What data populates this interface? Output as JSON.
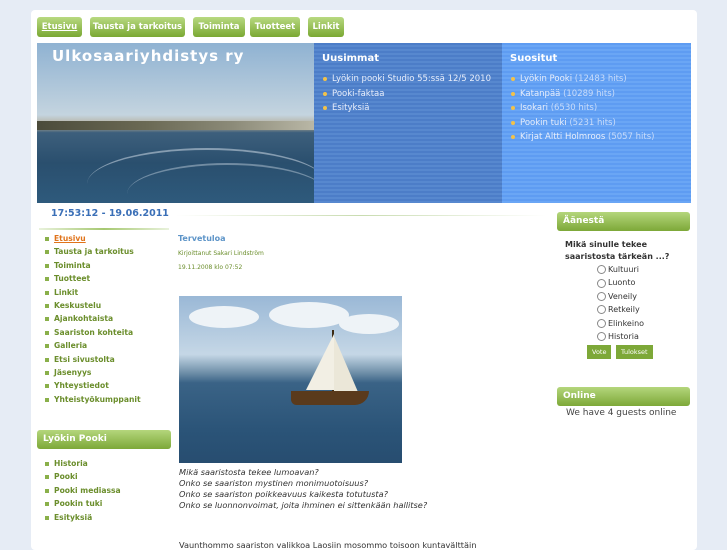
{
  "nav": {
    "tabs": [
      {
        "label": "Etusivu"
      },
      {
        "label": "Tausta ja tarkoitus"
      },
      {
        "label": "Toiminta"
      },
      {
        "label": "Tuotteet"
      },
      {
        "label": "Linkit"
      }
    ]
  },
  "header": {
    "site_title": "Ulkosaariyhdistys ry",
    "latest": {
      "title": "Uusimmat",
      "items": [
        "Lyökin pooki Studio 55:ssä 12/5 2010",
        "Pooki-faktaa",
        "Esityksiä"
      ]
    },
    "popular": {
      "title": "Suositut",
      "items": [
        {
          "label": "Lyökin Pooki",
          "hits": "(12483 hits)"
        },
        {
          "label": "Katanpää",
          "hits": "(10289 hits)"
        },
        {
          "label": "Isokari",
          "hits": "(6530 hits)"
        },
        {
          "label": "Pookin tuki",
          "hits": "(5231 hits)"
        },
        {
          "label": "Kirjat Altti Holmroos",
          "hits": "(5057 hits)"
        }
      ]
    }
  },
  "clock": "17:53:12 - 19.06.2011",
  "main_menu": [
    "Etusivu",
    "Tausta ja tarkoitus",
    "Toiminta",
    "Tuotteet",
    "Linkit",
    "Keskustelu",
    "Ajankohtaista",
    "Saariston kohteita",
    "Galleria",
    "Etsi sivustolta",
    "Jäsenyys",
    "Yhteystiedot",
    "Yhteistyökumppanit"
  ],
  "pooki_menu": {
    "title": "Lyökin Pooki",
    "items": [
      "Historia",
      "Pooki",
      "Pooki mediassa",
      "Pookin tuki",
      "Esityksiä"
    ]
  },
  "article": {
    "title": "Tervetuloa",
    "author": "Kirjoittanut Sakari Lindström",
    "date": "19.11.2008 klo 07:52",
    "poem": [
      "Mikä saaristosta tekee lumoavan?",
      "Onko se saariston mystinen monimuotoisuus?",
      "Onko se saariston poikkeavuus kaikesta totutusta?",
      "Onko se luonnonvoimat, joita ihminen ei sittenkään hallitse?"
    ],
    "partial_text": "Vaunthommo saariston valikkoa Laosiin mosommo toisoon kuntavälttäin"
  },
  "poll": {
    "title": "Äänestä",
    "question": "Mikä sinulle tekee saaristosta tärkeän ...?",
    "options": [
      "Kultuuri",
      "Luonto",
      "Veneily",
      "Retkeily",
      "Elinkeino",
      "Historia"
    ],
    "vote_label": "Vote",
    "results_label": "Tulokset"
  },
  "online": {
    "title": "Online",
    "text": "We have 4 guests online"
  },
  "colors": {
    "green_accent": "#7da838",
    "link_green": "#6b8e2c",
    "active_orange": "#e0731a",
    "header_blue": "#4c7dc8"
  }
}
